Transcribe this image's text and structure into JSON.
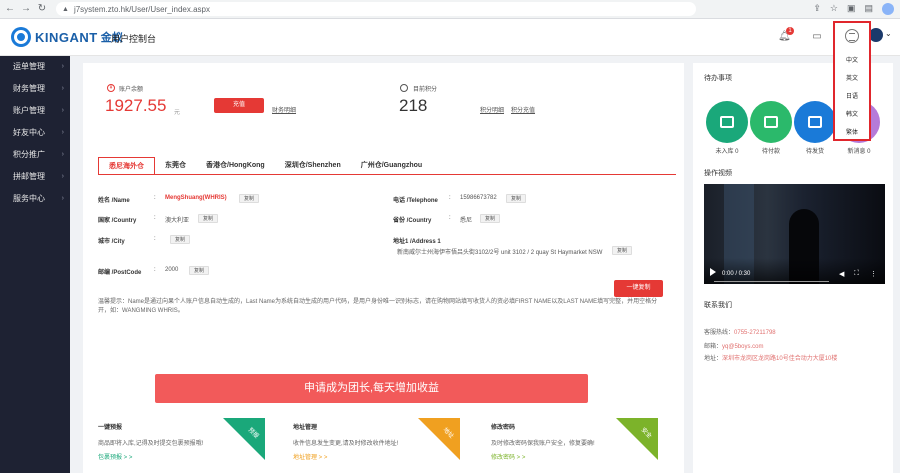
{
  "browser": {
    "url": "j7system.zto.hk/User/User_index.aspx"
  },
  "header": {
    "brand_text": "KINGANT",
    "brand_cn": "金蚁",
    "title": "用户控制台",
    "notification_count": "1"
  },
  "language_menu": {
    "items": [
      "中文",
      "英文",
      "日语",
      "韩文",
      "繁体"
    ]
  },
  "sidebar": {
    "items": [
      {
        "label": "运单管理"
      },
      {
        "label": "财务管理"
      },
      {
        "label": "账户管理"
      },
      {
        "label": "好友中心"
      },
      {
        "label": "积分推广"
      },
      {
        "label": "拼邮管理"
      },
      {
        "label": "服务中心"
      }
    ]
  },
  "balance": {
    "label": "账户余额",
    "value": "1927.55",
    "unit": "元",
    "recharge_label": "充值",
    "details_link": "财务明细"
  },
  "points": {
    "label": "目前积分",
    "value": "218",
    "details_link": "积分明细",
    "recharge_link": "积分充值"
  },
  "warehouse_tabs": [
    {
      "label": "悉尼海外仓",
      "active": true
    },
    {
      "label": "东莞仓",
      "active": false
    },
    {
      "label": "香港仓/HongKong",
      "active": false
    },
    {
      "label": "深圳仓/Shenzhen",
      "active": false
    },
    {
      "label": "广州仓/Guangzhou",
      "active": false
    }
  ],
  "address": {
    "name_label": "姓名 /Name",
    "name_value": "MengShuang(WHRIS)",
    "phone_label": "电话 /Telephone",
    "phone_value": "15986673782",
    "country_label": "国家 /Country",
    "country_value": "澳大利亚",
    "province_label": "省份 /Country",
    "province_value": "悉尼",
    "city_label": "城市 /City",
    "address_label": "地址1 /Address 1",
    "address_value": "新南威尔士州海伊市悟吕头街3102/2号 unit 3102 / 2  quay St Haymarket NSW",
    "postcode_label": "邮编 /PostCode",
    "postcode_value": "2000",
    "copy_label": "复制",
    "onekey_copy_label": "一键复制"
  },
  "tip": "温馨提示：Name是通过向果个人账户信息自动生成的，Last Name为系统自动生成的用户代码，是用户身份唯一识别标志，请在购物网站填写收货人的资必填FIRST NAME以及LAST NAME填写完整，并用空格分开，如：WANGMING WHRIS。",
  "promo": {
    "label": "申请成为团长,每天增加收益"
  },
  "cards": [
    {
      "title": "一键预报",
      "desc": "商品即将入库,记得及时提交包裹预报哦!",
      "link": "包裹预报 > >",
      "ribbon": "预报",
      "color": "#1aa87a",
      "link_color": "#1aa87a"
    },
    {
      "title": "地址管理",
      "desc": "收件信息发生变更,请及时修改收件地址!",
      "link": "地址管理 > >",
      "ribbon": "地址",
      "color": "#f0a020",
      "link_color": "#f0a020"
    },
    {
      "title": "修改密码",
      "desc": "及时修改密码保我账户安全，修复要确!",
      "link": "修改密码 > >",
      "ribbon": "安全",
      "color": "#7cb32a",
      "link_color": "#7cb32a"
    }
  ],
  "right_panel": {
    "todo_title": "待办事项",
    "todo_items": [
      {
        "label": "未入库 0",
        "color": "#1aa87a"
      },
      {
        "label": "待付款",
        "color": "#2bb96b"
      },
      {
        "label": "待发货",
        "color": "#1a7ad8"
      },
      {
        "label": "新消息 0",
        "color": "#b57bd9"
      }
    ],
    "video_title": "操作视频",
    "video_time": "0:00 / 0:30",
    "contact_title": "联系我们",
    "contact": [
      {
        "label": "客服热线：",
        "value": "0755-27211798"
      },
      {
        "label": "邮箱：",
        "value": "yq@5boys.com"
      },
      {
        "label": "地址：",
        "value": "深圳市龙岗区龙岗路10号佳合动力大厦10楼"
      }
    ]
  }
}
